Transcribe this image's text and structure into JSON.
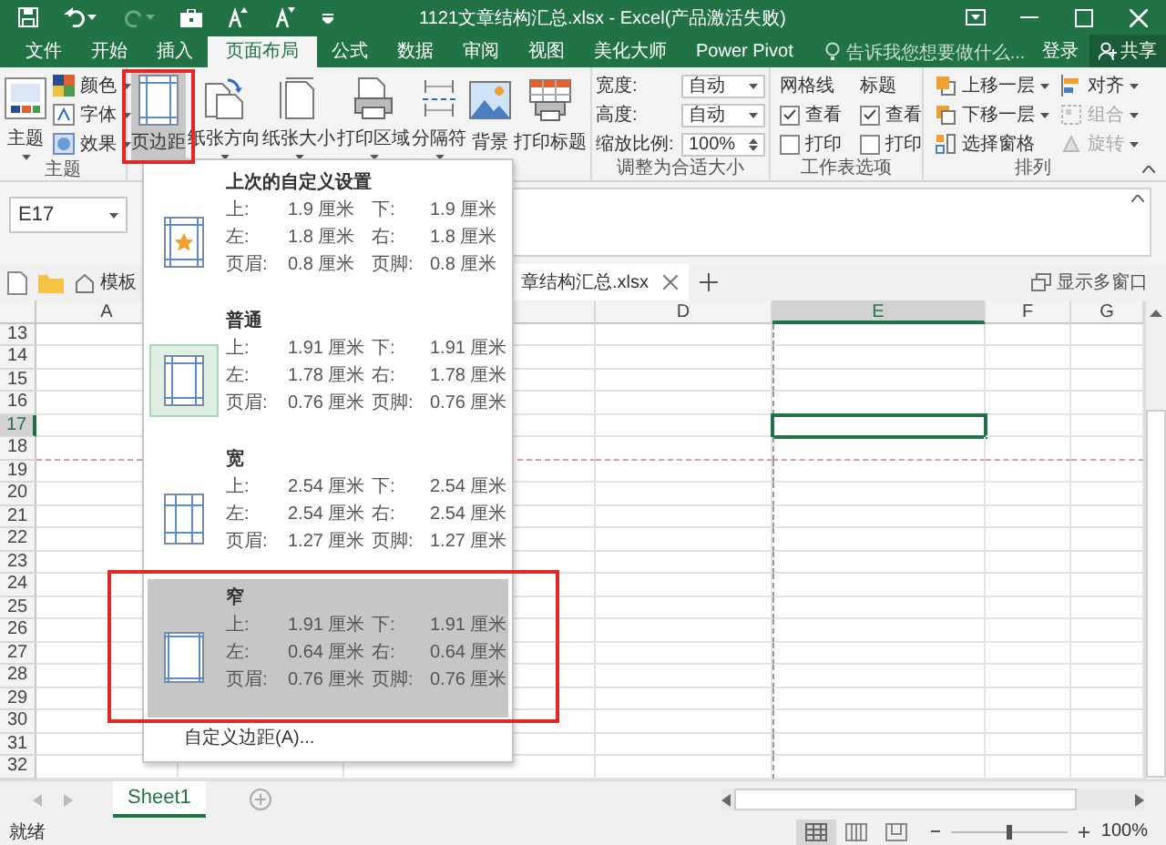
{
  "title_bar": {
    "title": "1121文章结构汇总.xlsx - Excel(产品激活失败)"
  },
  "tabs": [
    {
      "label": "文件",
      "selected": false
    },
    {
      "label": "开始",
      "selected": false
    },
    {
      "label": "插入",
      "selected": false
    },
    {
      "label": "页面布局",
      "selected": true
    },
    {
      "label": "公式",
      "selected": false
    },
    {
      "label": "数据",
      "selected": false
    },
    {
      "label": "审阅",
      "selected": false
    },
    {
      "label": "视图",
      "selected": false
    },
    {
      "label": "美化大师",
      "selected": false
    },
    {
      "label": "Power Pivot",
      "selected": false
    }
  ],
  "tell_me": {
    "placeholder": "告诉我您想要做什么..."
  },
  "sign_in": "登录",
  "share": "共享",
  "themes_group": {
    "label": "主题",
    "button": "主题",
    "items": [
      "颜色",
      "字体",
      "效果"
    ]
  },
  "page_setup_buttons": [
    {
      "label": "页边距",
      "pressed": true,
      "dropdown": true
    },
    {
      "label": "纸张方向",
      "pressed": false,
      "dropdown": true
    },
    {
      "label": "纸张大小",
      "pressed": false,
      "dropdown": true
    },
    {
      "label": "打印区域",
      "pressed": false,
      "dropdown": true
    },
    {
      "label": "分隔符",
      "pressed": false,
      "dropdown": true
    },
    {
      "label": "背景",
      "pressed": false,
      "dropdown": false
    },
    {
      "label": "打印标题",
      "pressed": false,
      "dropdown": false
    }
  ],
  "scale_group": {
    "label": "调整为合适大小",
    "fields": [
      {
        "label": "宽度:",
        "value": "自动",
        "kind": "dropdown"
      },
      {
        "label": "高度:",
        "value": "自动",
        "kind": "dropdown"
      },
      {
        "label": "缩放比例:",
        "value": "100%",
        "kind": "spinner"
      }
    ]
  },
  "sheet_options": {
    "label": "工作表选项",
    "columns": [
      {
        "heading": "网格线",
        "options": [
          {
            "label": "查看",
            "checked": true
          },
          {
            "label": "打印",
            "checked": false
          }
        ]
      },
      {
        "heading": "标题",
        "options": [
          {
            "label": "查看",
            "checked": true
          },
          {
            "label": "打印",
            "checked": false
          }
        ]
      }
    ]
  },
  "arrange": {
    "label": "排列",
    "items": [
      {
        "label": "上移一层",
        "dropdown": true,
        "disabled": false
      },
      {
        "label": "下移一层",
        "dropdown": true,
        "disabled": false
      },
      {
        "label": "选择窗格",
        "dropdown": false,
        "disabled": false
      },
      {
        "label": "对齐",
        "dropdown": true,
        "disabled": false
      },
      {
        "label": "组合",
        "dropdown": true,
        "disabled": true
      },
      {
        "label": "旋转",
        "dropdown": true,
        "disabled": true
      }
    ]
  },
  "name_box": {
    "value": "E17"
  },
  "doc_tabs": [
    {
      "label": "模板",
      "kind": "template"
    },
    {
      "label": "章结构汇总.xlsx",
      "kind": "file"
    }
  ],
  "multi_window": "显示多窗口",
  "sheet": {
    "columns": [
      {
        "label": "A",
        "selected": false
      },
      {
        "label": "D",
        "selected": false
      },
      {
        "label": "E",
        "selected": true
      },
      {
        "label": "F",
        "selected": false
      },
      {
        "label": "G",
        "selected": false
      }
    ],
    "rows": [
      {
        "label": "13",
        "selected": false
      },
      {
        "label": "14",
        "selected": false
      },
      {
        "label": "15",
        "selected": false
      },
      {
        "label": "16",
        "selected": false
      },
      {
        "label": "17",
        "selected": true
      },
      {
        "label": "18",
        "selected": false
      },
      {
        "label": "19",
        "selected": false
      },
      {
        "label": "20",
        "selected": false
      },
      {
        "label": "21",
        "selected": false
      },
      {
        "label": "22",
        "selected": false
      },
      {
        "label": "23",
        "selected": false
      },
      {
        "label": "24",
        "selected": false
      },
      {
        "label": "25",
        "selected": false
      },
      {
        "label": "26",
        "selected": false
      },
      {
        "label": "27",
        "selected": false
      },
      {
        "label": "28",
        "selected": false
      },
      {
        "label": "29",
        "selected": false
      },
      {
        "label": "30",
        "selected": false
      },
      {
        "label": "31",
        "selected": false
      },
      {
        "label": "32",
        "selected": false
      }
    ]
  },
  "sheet_tabs": [
    {
      "label": "Sheet1",
      "selected": true
    }
  ],
  "status_bar": {
    "text": "就绪",
    "views": [
      {
        "kind": "normal",
        "selected": true
      },
      {
        "kind": "page-layout",
        "selected": false
      },
      {
        "kind": "page-break",
        "selected": false
      }
    ],
    "zoom_slider": {
      "level": 0.5
    },
    "zoom": "100%"
  },
  "margins_menu": {
    "items": [
      {
        "title": "上次的自定义设置",
        "selected": false,
        "hovered": false,
        "rows": [
          {
            "label_1": "上:",
            "value_1": "1.9 厘米",
            "label_2": "下:",
            "value_2": "1.9 厘米"
          },
          {
            "label_1": "左:",
            "value_1": "1.8 厘米",
            "label_2": "右:",
            "value_2": "1.8 厘米"
          },
          {
            "label_1": "页眉:",
            "value_1": "0.8 厘米",
            "label_2": "页脚:",
            "value_2": "0.8 厘米"
          }
        ]
      },
      {
        "title": "普通",
        "selected": true,
        "hovered": false,
        "rows": [
          {
            "label_1": "上:",
            "value_1": "1.91 厘米",
            "label_2": "下:",
            "value_2": "1.91 厘米"
          },
          {
            "label_1": "左:",
            "value_1": "1.78 厘米",
            "label_2": "右:",
            "value_2": "1.78 厘米"
          },
          {
            "label_1": "页眉:",
            "value_1": "0.76 厘米",
            "label_2": "页脚:",
            "value_2": "0.76 厘米"
          }
        ]
      },
      {
        "title": "宽",
        "selected": false,
        "hovered": false,
        "rows": [
          {
            "label_1": "上:",
            "value_1": "2.54 厘米",
            "label_2": "下:",
            "value_2": "2.54 厘米"
          },
          {
            "label_1": "左:",
            "value_1": "2.54 厘米",
            "label_2": "右:",
            "value_2": "2.54 厘米"
          },
          {
            "label_1": "页眉:",
            "value_1": "1.27 厘米",
            "label_2": "页脚:",
            "value_2": "1.27 厘米"
          }
        ]
      },
      {
        "title": "窄",
        "selected": false,
        "hovered": true,
        "rows": [
          {
            "label_1": "上:",
            "value_1": "1.91 厘米",
            "label_2": "下:",
            "value_2": "1.91 厘米"
          },
          {
            "label_1": "左:",
            "value_1": "0.64 厘米",
            "label_2": "右:",
            "value_2": "0.64 厘米"
          },
          {
            "label_1": "页眉:",
            "value_1": "0.76 厘米",
            "label_2": "页脚:",
            "value_2": "0.76 厘米"
          }
        ]
      }
    ],
    "footer": "自定义边距(A)..."
  }
}
